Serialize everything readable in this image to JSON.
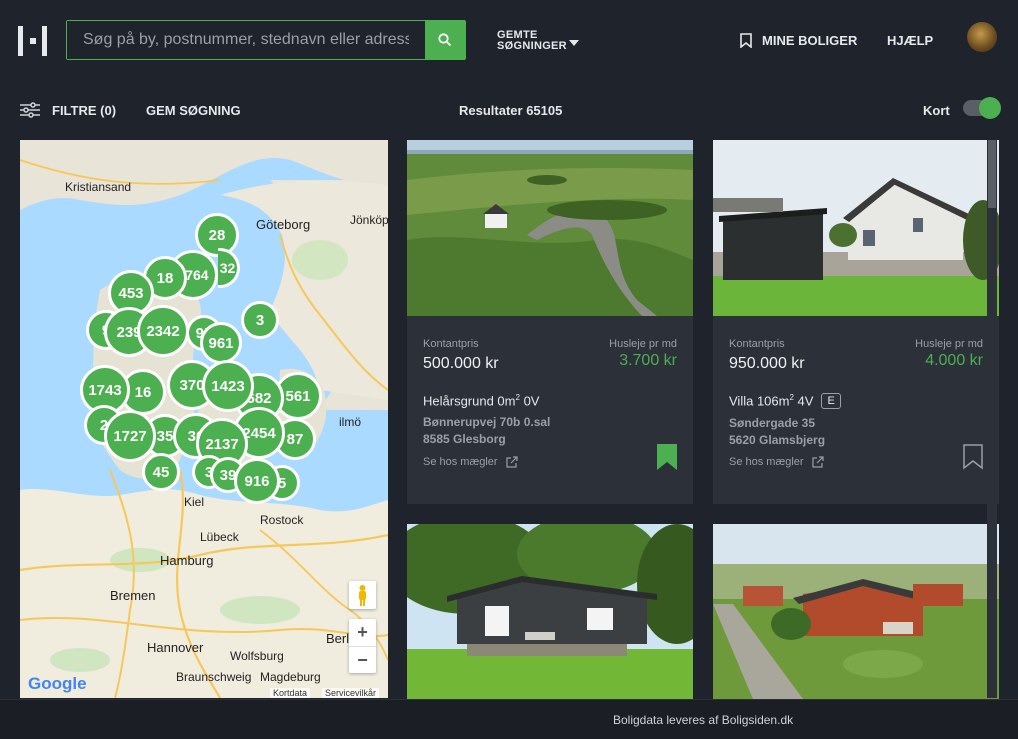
{
  "header": {
    "search_placeholder": "Søg på by, postnummer, stednavn eller adresse",
    "saved_line1": "GEMTE",
    "saved_line2": "SØGNINGER",
    "my_homes": "MINE BOLIGER",
    "help": "HJÆLP"
  },
  "subbar": {
    "filter": "FILTRE (0)",
    "save_search": "GEM SØGNING",
    "results": "Resultater 65105",
    "map_toggle": "Kort",
    "map_toggle_on": true
  },
  "map": {
    "cities": [
      "Kristiansand",
      "Göteborg",
      "Jönköp",
      "Kiel",
      "Rostock",
      "Lübeck",
      "Hamburg",
      "Bremen",
      "Hannover",
      "Wolfsburg",
      "Braunschweig",
      "Magdeburg",
      "Berl",
      "ilmö"
    ],
    "clusters": [
      "28",
      "3764",
      "32",
      "18",
      "453",
      "3",
      "2342",
      "239",
      "9",
      "961",
      "95",
      "1743",
      "16",
      "370",
      "1423",
      "682",
      "561",
      "1727",
      "35",
      "36",
      "2137",
      "2454",
      "87",
      "45",
      "3",
      "39",
      "916",
      "5",
      "2"
    ],
    "attribution": [
      "Kortdata",
      "Servicevilkår"
    ],
    "google": "Google",
    "zoom_in": "+",
    "zoom_out": "−"
  },
  "listings": [
    {
      "price_label": "Kontantpris",
      "price": "500.000 kr",
      "rent_label": "Husleje pr md",
      "rent": "3.700 kr",
      "type": "Helårsgrund 0m",
      "type_sup": "2",
      "type_rest": " 0V",
      "energy": "",
      "street": "Bønnerupvej 70b 0.sal",
      "city": "8585 Glesborg",
      "broker": "Se hos mægler",
      "saved": true
    },
    {
      "price_label": "Kontantpris",
      "price": "950.000 kr",
      "rent_label": "Husleje pr md",
      "rent": "4.000 kr",
      "type": "Villa 106m",
      "type_sup": "2",
      "type_rest": " 4V",
      "energy": "E",
      "street": "Søndergade 35",
      "city": "5620 Glamsbjerg",
      "broker": "Se hos mægler",
      "saved": false
    }
  ],
  "footer": "Boligdata leveres af Boligsiden.dk"
}
